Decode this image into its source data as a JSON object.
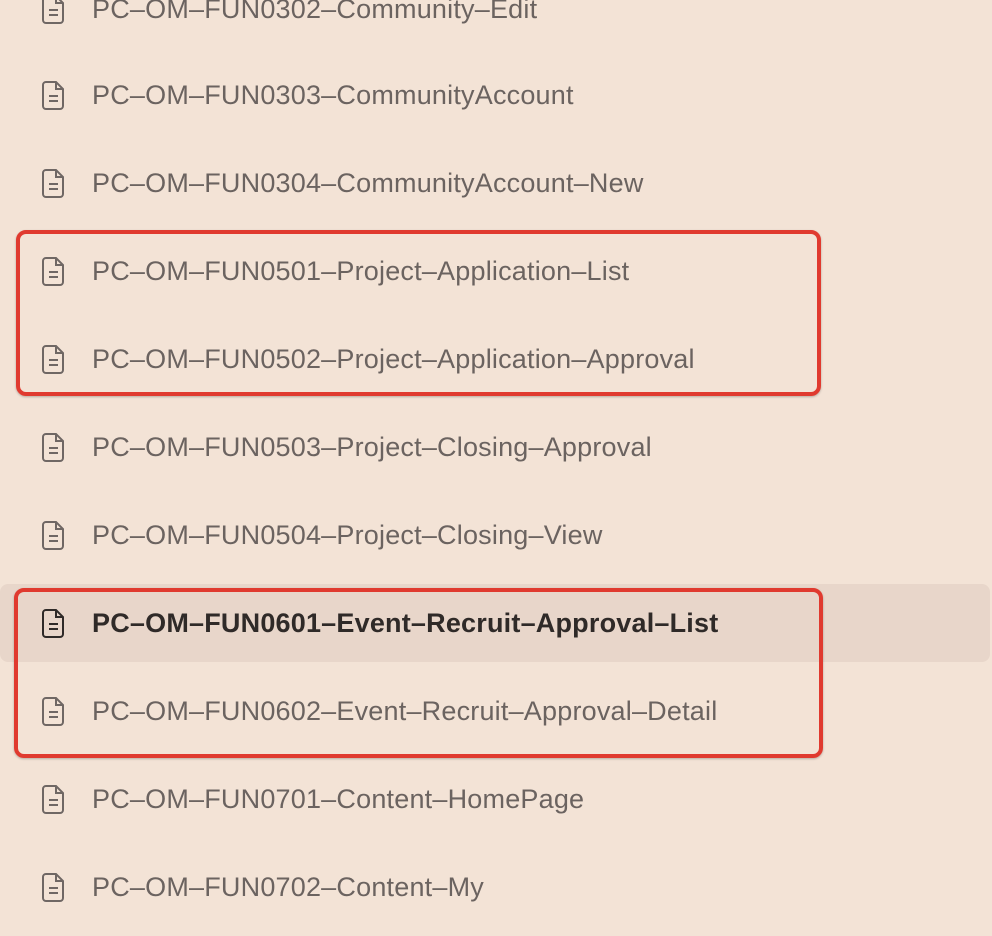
{
  "files": [
    {
      "label": "PC–OM–FUN0302–Community–Edit",
      "icon": "document-icon",
      "selected": false
    },
    {
      "label": "PC–OM–FUN0303–CommunityAccount",
      "icon": "document-icon",
      "selected": false
    },
    {
      "label": "PC–OM–FUN0304–CommunityAccount–New",
      "icon": "document-icon",
      "selected": false
    },
    {
      "label": "PC–OM–FUN0501–Project–Application–List",
      "icon": "document-icon",
      "selected": false
    },
    {
      "label": "PC–OM–FUN0502–Project–Application–Approval",
      "icon": "document-icon",
      "selected": false
    },
    {
      "label": "PC–OM–FUN0503–Project–Closing–Approval",
      "icon": "document-icon",
      "selected": false
    },
    {
      "label": "PC–OM–FUN0504–Project–Closing–View",
      "icon": "document-icon",
      "selected": false
    },
    {
      "label": "PC–OM–FUN0601–Event–Recruit–Approval–List",
      "icon": "document-icon",
      "selected": true
    },
    {
      "label": "PC–OM–FUN0602–Event–Recruit–Approval–Detail",
      "icon": "document-icon",
      "selected": false
    },
    {
      "label": "PC–OM–FUN0701–Content–HomePage",
      "icon": "document-icon",
      "selected": false
    },
    {
      "label": "PC–OM–FUN0702–Content–My",
      "icon": "document-icon",
      "selected": false
    }
  ],
  "colors": {
    "background": "#f3e3d6",
    "selected_row": "#e8d6ca",
    "highlight_border": "#e03a2f",
    "text": "#6b6360",
    "selected_text": "#2f2a28"
  }
}
